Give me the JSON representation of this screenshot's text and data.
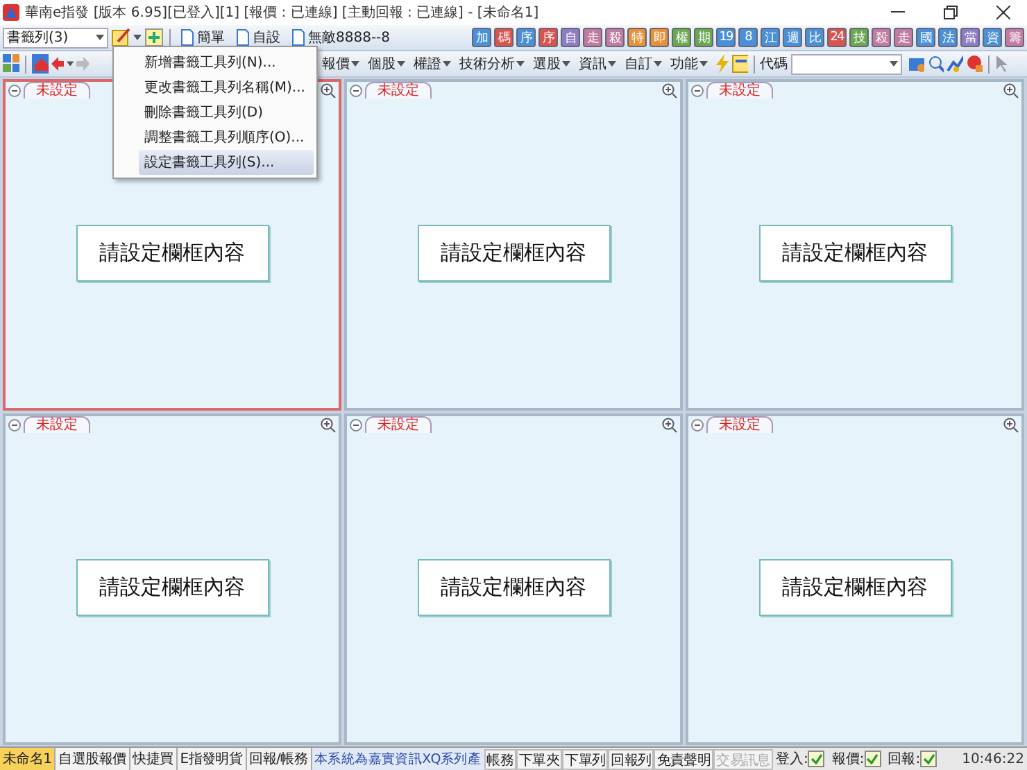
{
  "window": {
    "title": "華南e指發 [版本 6.95][已登入][1] [報價 : 已連線] [主動回報 : 已連線] - [未命名1]"
  },
  "bookmark_bar": {
    "selector": "書籤列(3)",
    "bookmarks": [
      "簡單",
      "自設",
      "無敵8888--8"
    ]
  },
  "quick_buttons": [
    {
      "label": "加",
      "color": "#4a90d9"
    },
    {
      "label": "碼",
      "color": "#d9534f"
    },
    {
      "label": "序",
      "color": "#4a90d9"
    },
    {
      "label": "序",
      "color": "#d9534f"
    },
    {
      "label": "自",
      "color": "#8e7cc3"
    },
    {
      "label": "走",
      "color": "#c27ba0"
    },
    {
      "label": "殺",
      "color": "#c27ba0"
    },
    {
      "label": "特",
      "color": "#e69138"
    },
    {
      "label": "即",
      "color": "#e69138"
    },
    {
      "label": "權",
      "color": "#6aa84f"
    },
    {
      "label": "期",
      "color": "#6aa84f"
    },
    {
      "label": "19",
      "color": "#4a90d9"
    },
    {
      "label": "8",
      "color": "#4a90d9"
    },
    {
      "label": "江",
      "color": "#4a90d9"
    },
    {
      "label": "週",
      "color": "#4a90d9"
    },
    {
      "label": "比",
      "color": "#4a90d9"
    },
    {
      "label": "24",
      "color": "#d9534f"
    },
    {
      "label": "技",
      "color": "#6aa84f"
    },
    {
      "label": "殺",
      "color": "#c27ba0"
    },
    {
      "label": "走",
      "color": "#c27ba0"
    },
    {
      "label": "國",
      "color": "#4a90d9"
    },
    {
      "label": "法",
      "color": "#4a90d9"
    },
    {
      "label": "當",
      "color": "#8e7cc3"
    },
    {
      "label": "資",
      "color": "#4a90d9"
    },
    {
      "label": "籌",
      "color": "#c27ba0"
    }
  ],
  "menus": [
    "報價",
    "個股",
    "權證",
    "技術分析",
    "選股",
    "資訊",
    "自訂",
    "功能"
  ],
  "code_field": {
    "label": "代碼"
  },
  "bookmark_menu": [
    {
      "label": "新增書籤工具列(N)...",
      "selected": false
    },
    {
      "label": "更改書籤工具列名稱(M)...",
      "selected": false
    },
    {
      "label": "刪除書籤工具列(D)",
      "selected": false
    },
    {
      "label": "調整書籤工具列順序(O)...",
      "selected": false
    },
    {
      "label": "設定書籤工具列(S)...",
      "selected": true
    }
  ],
  "panels": [
    {
      "tab": "未設定",
      "prompt": "請設定欄框內容",
      "selected": true
    },
    {
      "tab": "未設定",
      "prompt": "請設定欄框內容",
      "selected": false
    },
    {
      "tab": "未設定",
      "prompt": "請設定欄框內容",
      "selected": false
    },
    {
      "tab": "未設定",
      "prompt": "請設定欄框內容",
      "selected": false
    },
    {
      "tab": "未設定",
      "prompt": "請設定欄框內容",
      "selected": false
    },
    {
      "tab": "未設定",
      "prompt": "請設定欄框內容",
      "selected": false
    }
  ],
  "status_bar": {
    "tabs": [
      {
        "label": "未命名1",
        "selected": true
      },
      {
        "label": "自選股報價",
        "selected": false
      },
      {
        "label": "快捷買",
        "selected": false
      },
      {
        "label": "E指發明貨",
        "selected": false
      },
      {
        "label": "回報/帳務",
        "selected": false
      }
    ],
    "notice": "本系統為嘉實資訊XQ系列產",
    "buttons": [
      {
        "label": "帳務",
        "disabled": false
      },
      {
        "label": "下單夾",
        "disabled": false
      },
      {
        "label": "下單列",
        "disabled": false
      },
      {
        "label": "回報列",
        "disabled": false
      },
      {
        "label": "免責聲明",
        "disabled": false
      },
      {
        "label": "交易訊息",
        "disabled": true
      }
    ],
    "indicators": [
      {
        "label": "登入:",
        "checked": true
      },
      {
        "label": "報價:",
        "checked": true
      },
      {
        "label": "回報:",
        "checked": true
      }
    ],
    "time": "10:46:22"
  }
}
